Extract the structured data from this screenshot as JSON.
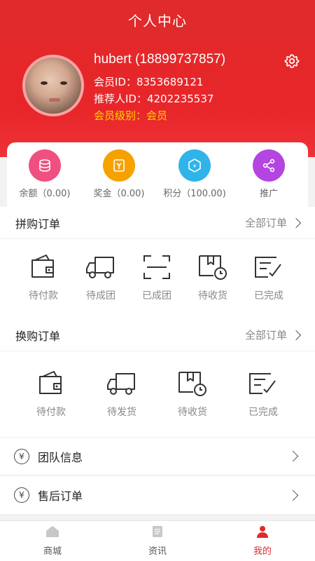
{
  "header": {
    "title": "个人中心"
  },
  "profile": {
    "username": "hubert (18899737857)",
    "member_id": "会员ID：8353689121",
    "referrer_id": "推荐人ID：4202235537",
    "level": "会员级别：会员"
  },
  "stats": [
    {
      "label": "余额（0.00)",
      "color": "#f0507f",
      "icon": "coins-icon"
    },
    {
      "label": "奖金（0.00)",
      "color": "#f5a200",
      "icon": "bonus-icon"
    },
    {
      "label": "积分（100.00)",
      "color": "#2fb4e9",
      "icon": "points-icon"
    },
    {
      "label": "推广",
      "color": "#b445e0",
      "icon": "share-icon"
    }
  ],
  "group_orders": {
    "title": "拼购订单",
    "more": "全部订单",
    "items": [
      "待付款",
      "待成团",
      "已成团",
      "待收货",
      "已完成"
    ]
  },
  "exchange_orders": {
    "title": "换购订单",
    "more": "全部订单",
    "items": [
      "待付款",
      "待发货",
      "待收货",
      "已完成"
    ]
  },
  "menu": [
    {
      "label": "团队信息"
    },
    {
      "label": "售后订单"
    }
  ],
  "tabs": [
    {
      "label": "商城"
    },
    {
      "label": "资讯"
    },
    {
      "label": "我的"
    }
  ],
  "colors": {
    "brand": "#e02a2b",
    "level_text": "#ffd400"
  }
}
